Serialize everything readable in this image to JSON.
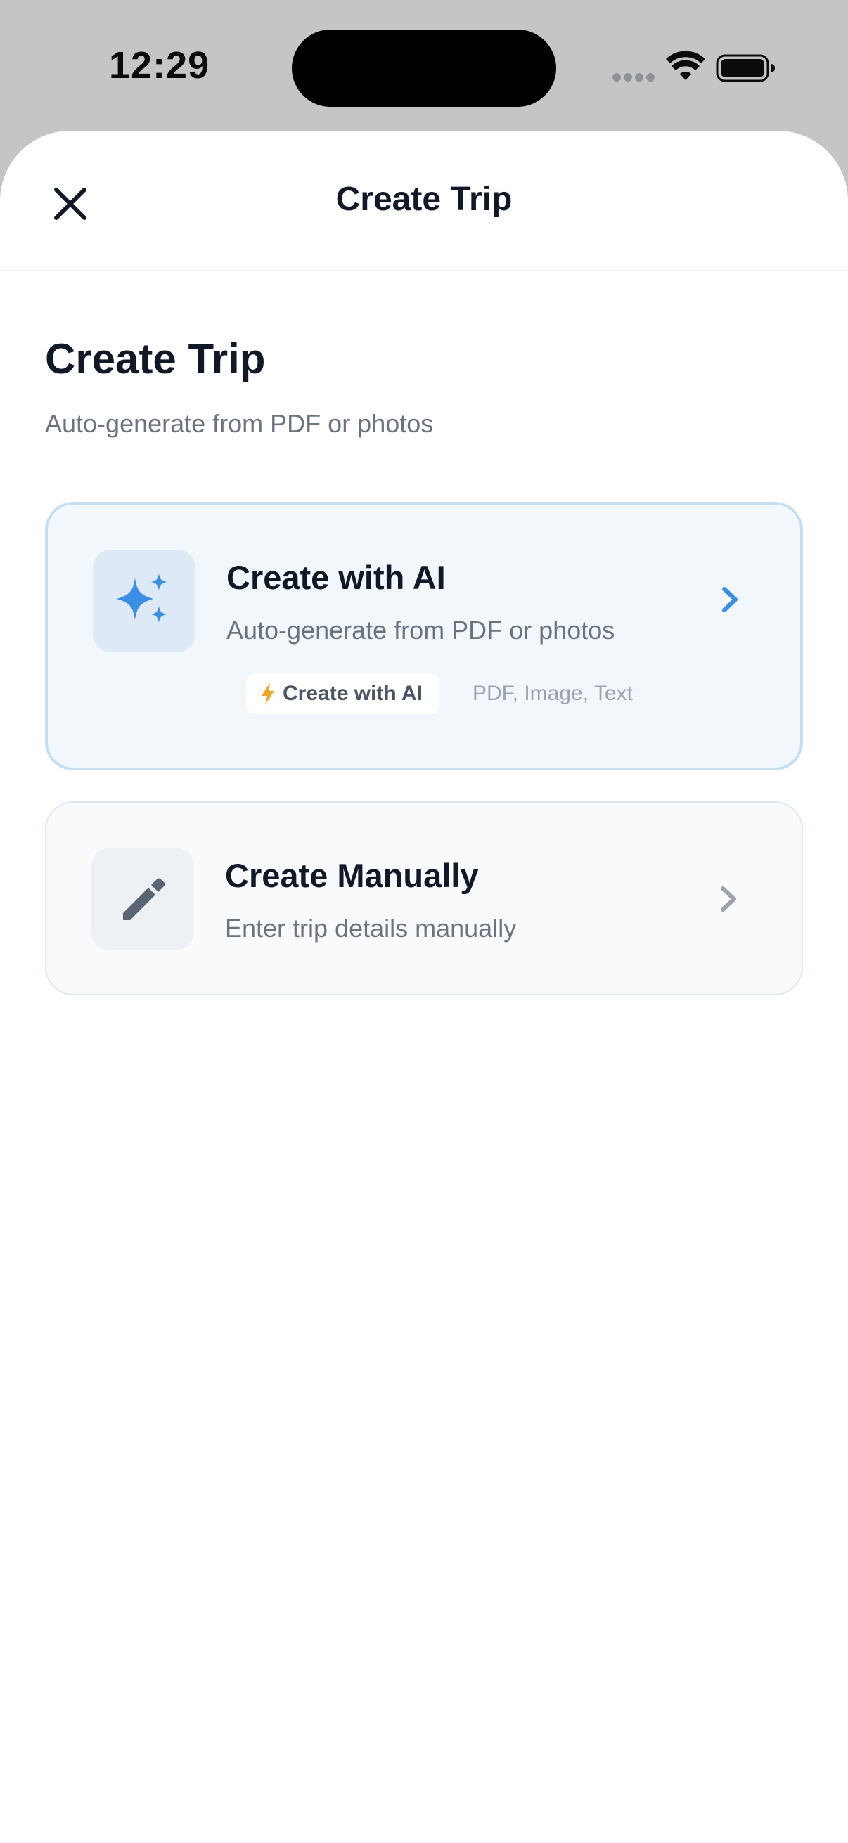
{
  "status_bar": {
    "time": "12:29"
  },
  "sheet": {
    "title": "Create Trip",
    "close_icon": "close-icon"
  },
  "page": {
    "title": "Create Trip",
    "subtitle": "Auto-generate from PDF or photos"
  },
  "options": {
    "ai": {
      "title": "Create with AI",
      "description": "Auto-generate from PDF or photos",
      "icon": "sparkles-icon",
      "badge_label": "Create with AI",
      "badge_icon": "lightning-icon",
      "formats": "PDF, Image, Text",
      "accent_color": "#3b8ee6"
    },
    "manual": {
      "title": "Create Manually",
      "description": "Enter trip details manually",
      "icon": "pencil-icon",
      "icon_color": "#5b6472"
    }
  },
  "colors": {
    "text_primary": "#111827",
    "text_secondary": "#6b7280",
    "badge_bolt": "#f0a526"
  }
}
